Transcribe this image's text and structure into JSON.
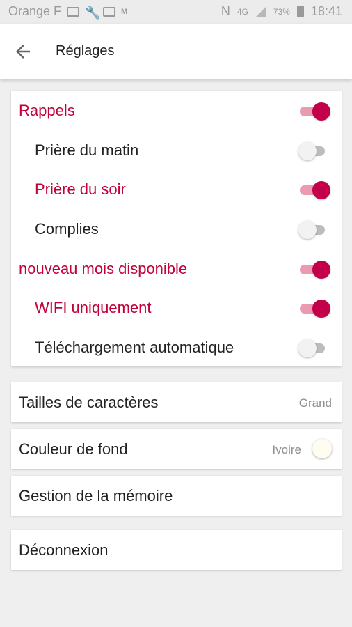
{
  "status_bar": {
    "carrier": "Orange F",
    "network": "4G",
    "battery": "73%",
    "time": "18:41"
  },
  "app_bar": {
    "title": "Réglages"
  },
  "reminders": {
    "items": [
      {
        "label": "Rappels",
        "enabled": true
      },
      {
        "label": "Prière du matin",
        "enabled": false
      },
      {
        "label": "Prière du soir",
        "enabled": true
      },
      {
        "label": "Complies",
        "enabled": false
      },
      {
        "label": "nouveau mois disponible",
        "enabled": true
      },
      {
        "label": "WIFI uniquement",
        "enabled": true
      },
      {
        "label": "Téléchargement automatique",
        "enabled": false
      }
    ]
  },
  "font_size": {
    "label": "Tailles de caractères",
    "value": "Grand"
  },
  "background_color": {
    "label": "Couleur de fond",
    "value": "Ivoire",
    "swatch": "#fffdf0"
  },
  "memory": {
    "label": "Gestion de la mémoire"
  },
  "logout": {
    "label": "Déconnexion"
  },
  "colors": {
    "accent": "#c4004b",
    "accent_light": "#ec9ab1",
    "text_active": "#c2003a"
  }
}
